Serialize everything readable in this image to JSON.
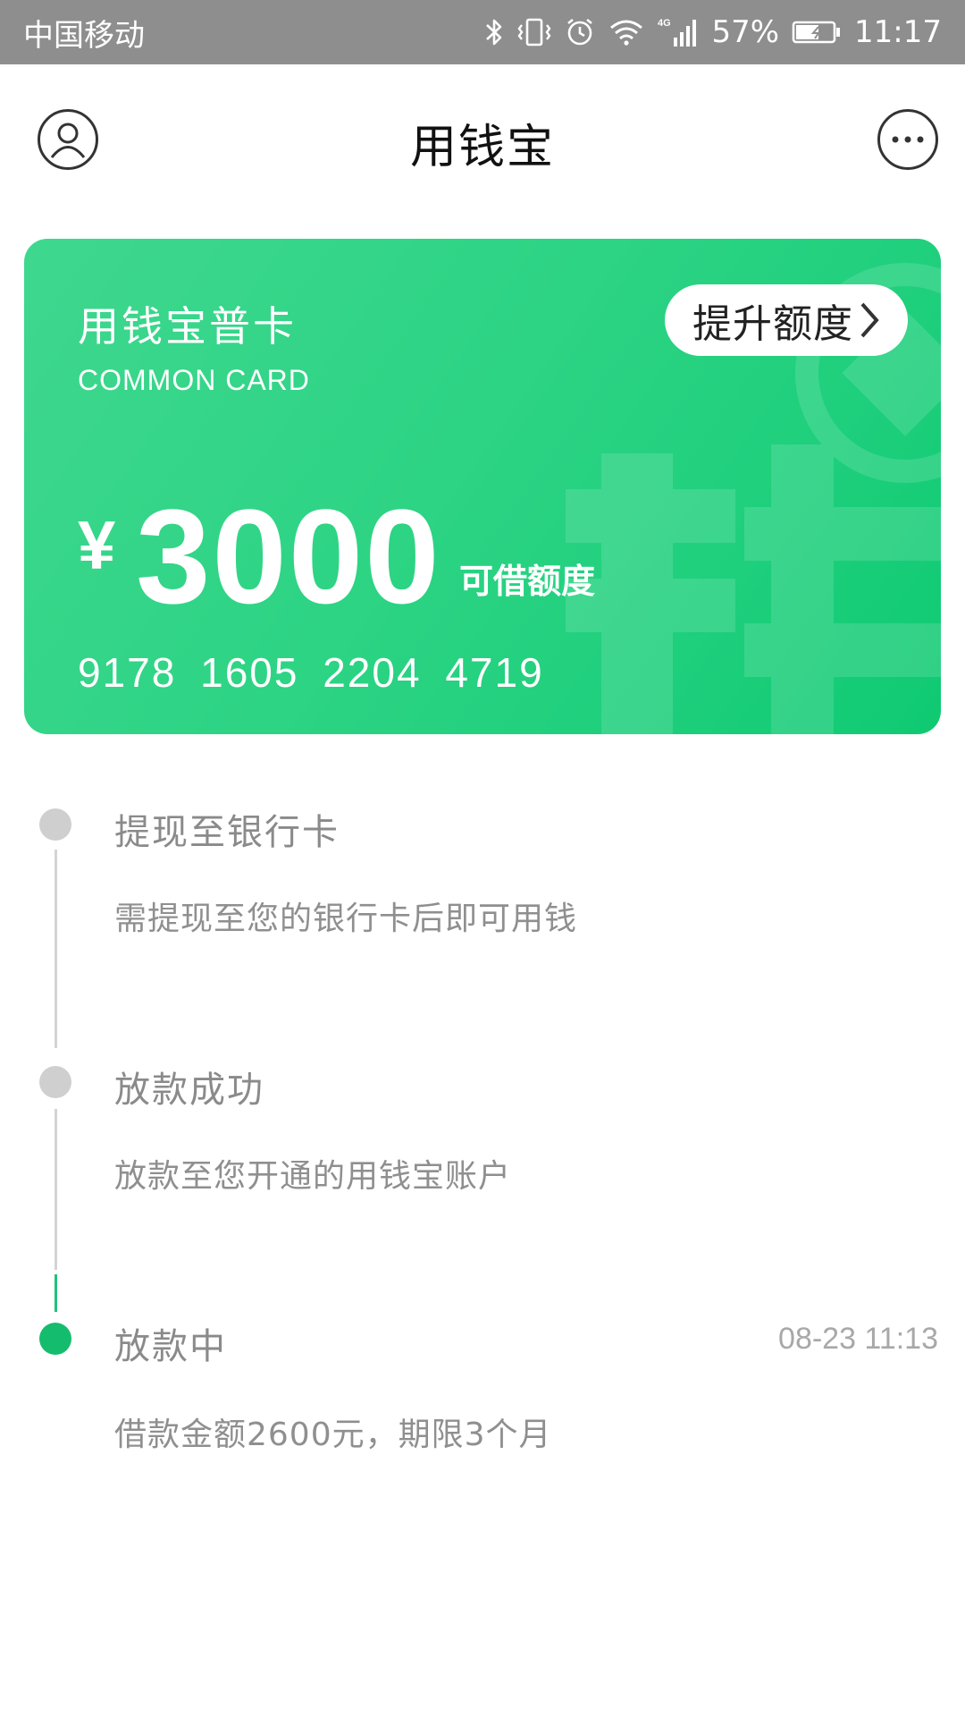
{
  "status_bar": {
    "carrier": "中国移动",
    "battery_percent": "57%",
    "time": "11:17",
    "network": "4G",
    "icons": [
      "bluetooth-icon",
      "vibrate-icon",
      "alarm-icon",
      "wifi-icon",
      "signal-icon",
      "battery-icon"
    ]
  },
  "header": {
    "title": "用钱宝",
    "left_icon": "profile-icon",
    "right_icon": "more-icon"
  },
  "card": {
    "name": "用钱宝普卡",
    "subtitle": "COMMON CARD",
    "upgrade_label": "提升额度",
    "currency_symbol": "¥",
    "amount": "3000",
    "amount_label": "可借额度",
    "card_number": "9178 1605 2204 4719",
    "colors": {
      "start": "#3fd78f",
      "end": "#0fca72"
    }
  },
  "timeline": {
    "steps": [
      {
        "title": "提现至银行卡",
        "description": "需提现至您的银行卡后即可用钱",
        "time": "",
        "active": false
      },
      {
        "title": "放款成功",
        "description": "放款至您开通的用钱宝账户",
        "time": "",
        "active": false
      },
      {
        "title": "放款中",
        "description": "借款金额2600元，期限3个月",
        "time": "08-23 11:13",
        "active": true
      }
    ],
    "colors": {
      "active": "#14bd6e",
      "inactive": "#cfcfcf"
    }
  }
}
